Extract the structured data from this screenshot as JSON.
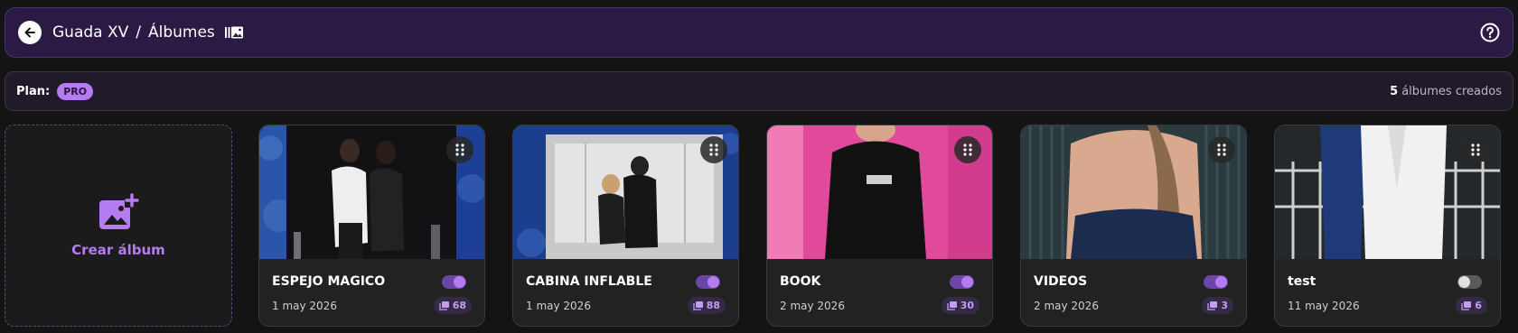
{
  "header": {
    "event_name": "Guada XV",
    "separator": "/",
    "section": "Álbumes",
    "icons": {
      "back": "arrow-left-icon",
      "albums": "photo-album-icon",
      "help": "question-circle-icon"
    }
  },
  "plan": {
    "label": "Plan:",
    "tier": "PRO"
  },
  "album_count": {
    "number": "5",
    "text": "álbumes creados"
  },
  "create": {
    "label": "Crear álbum",
    "icon": "add-photo-icon"
  },
  "albums": [
    {
      "title": "ESPEJO MAGICO",
      "date": "1 may 2026",
      "photos": "68",
      "enabled": true
    },
    {
      "title": "CABINA INFLABLE",
      "date": "1 may 2026",
      "photos": "88",
      "enabled": true
    },
    {
      "title": "BOOK",
      "date": "2 may 2026",
      "photos": "30",
      "enabled": true
    },
    {
      "title": "VIDEOS",
      "date": "2 may 2026",
      "photos": "3",
      "enabled": true
    },
    {
      "title": "test",
      "date": "11 may 2026",
      "photos": "6",
      "enabled": false
    }
  ],
  "colors": {
    "accent": "#b57cf2",
    "header_bg": "#2b1a43",
    "page_bg": "#141414"
  }
}
